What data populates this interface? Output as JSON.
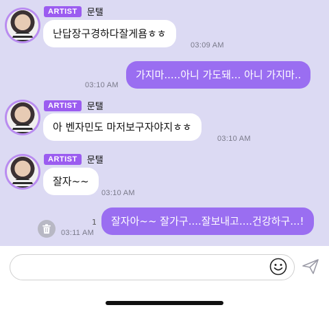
{
  "messages": [
    {
      "badge": "ARTIST",
      "sender": "문탤",
      "text": "난답장구경하다잘게욤ㅎㅎ",
      "time": "03:09 AM"
    },
    {
      "text": "가지마.....아니 가도돼... 아니 가지마..",
      "time": "03:10 AM"
    },
    {
      "badge": "ARTIST",
      "sender": "문탤",
      "text": "아 벤자민도 마저보구자야지ㅎㅎ",
      "time": "03:10 AM"
    },
    {
      "badge": "ARTIST",
      "sender": "문탤",
      "text": "잘자~~",
      "time": "03:10 AM"
    },
    {
      "text": "잘자아~~ 잘가구....잘보내고....건강하구...!",
      "time": "03:11 AM",
      "unread": "1"
    }
  ],
  "input": {
    "placeholder": ""
  },
  "icons": {
    "delete": "trash-icon",
    "emoji": "smiley-icon",
    "send": "send-icon"
  },
  "colors": {
    "background": "#dcdaf3",
    "outgoing_bubble": "#9a6ef1",
    "badge": "#9b5cf0"
  }
}
